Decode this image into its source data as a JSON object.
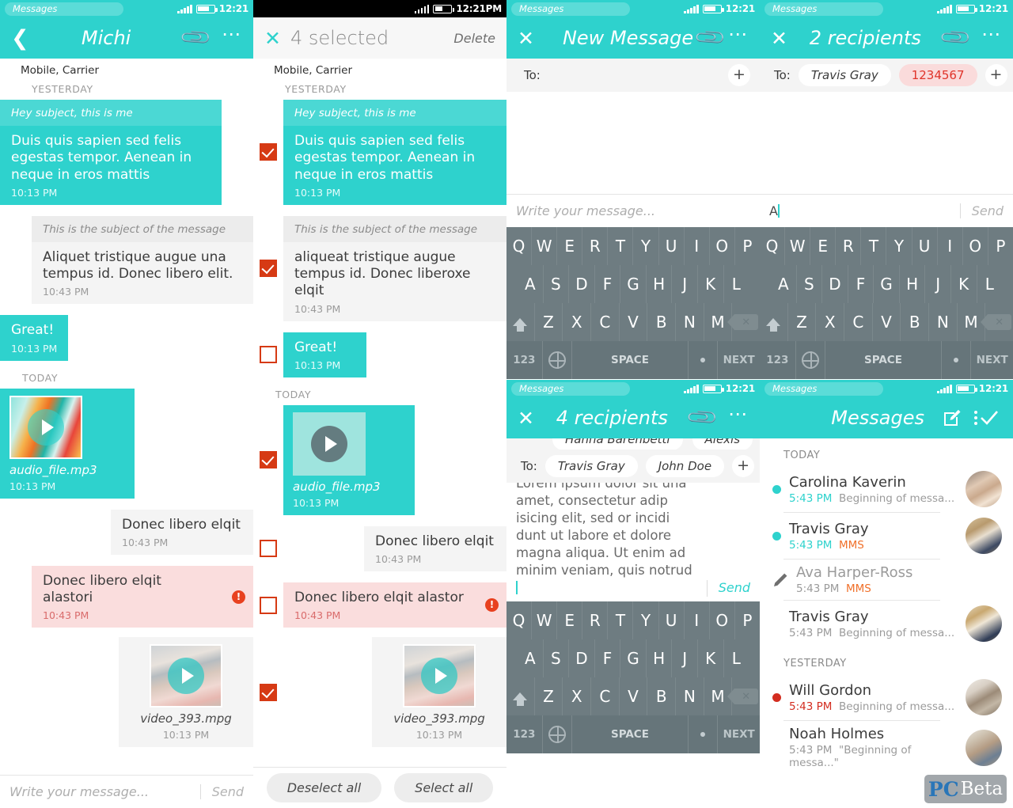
{
  "status": {
    "app_label": "Messages",
    "time": "12:21",
    "time_pm": "12:21PM"
  },
  "panel_conversation": {
    "title": "Michi",
    "carrier": "Mobile, Carrier",
    "day_yesterday": "YESTERDAY",
    "day_today": "TODAY",
    "compose_placeholder": "Write your message...",
    "send_label": "Send",
    "messages": [
      {
        "subject": "Hey subject, this is me",
        "text": "Duis quis sapien sed felis egestas tempor. Aenean in neque in eros mattis",
        "time": "10:13 PM"
      },
      {
        "subject": "This is the subject of the message",
        "text": "Aliquet tristique augue una tempus id. Donec libero elit.",
        "time": "10:43 PM"
      },
      {
        "text": "Great!",
        "time": "10:13 PM"
      },
      {
        "filename": "audio_file.mp3",
        "time": "10:13 PM"
      },
      {
        "text": "Donec libero elqit",
        "time": "10:43 PM"
      },
      {
        "text": "Donec libero elqit alastori",
        "time": "10:43 PM",
        "error": "!"
      },
      {
        "filename": "video_393.mpg",
        "time": "10:13 PM"
      }
    ]
  },
  "panel_selection": {
    "title": "4 selected",
    "delete_label": "Delete",
    "carrier": "Mobile, Carrier",
    "day_yesterday": "YESTERDAY",
    "day_today": "TODAY",
    "deselect_all_label": "Deselect all",
    "select_all_label": "Select all",
    "messages": [
      {
        "subject": "Hey subject, this is me",
        "text": "Duis quis sapien sed felis egestas tempor. Aenean in neque in eros mattis",
        "time": "10:13 PM",
        "checked": true
      },
      {
        "subject": "This is the subject of the message",
        "text": "aliqueat tristique augue tempus id. Donec liberoxe elqit",
        "time": "10:43 PM",
        "checked": true
      },
      {
        "text": "Great!",
        "time": "10:13 PM",
        "checked": false
      },
      {
        "filename": "audio_file.mp3",
        "time": "10:13 PM",
        "checked": true
      },
      {
        "text": "Donec libero elqit",
        "time": "10:43 PM",
        "checked": false
      },
      {
        "text": "Donec libero elqit alastor",
        "time": "10:43 PM",
        "checked": false,
        "error": "!"
      },
      {
        "filename": "video_393.mpg",
        "time": "10:13 PM",
        "checked": true
      }
    ]
  },
  "panel_new_message": {
    "title": "New Message",
    "to_label": "To:",
    "add_label": "+",
    "compose_placeholder": "Write your message...",
    "send_label": "Send"
  },
  "panel_two_recipients": {
    "title": "2 recipients",
    "to_label": "To:",
    "add_label": "+",
    "recipients": [
      {
        "name": "Travis Gray",
        "invalid": false
      },
      {
        "name": "1234567",
        "invalid": true
      }
    ],
    "typed_text": "A",
    "send_label": "Send"
  },
  "panel_four_recipients": {
    "title": "4 recipients",
    "to_label": "To:",
    "add_label": "+",
    "recipients_hidden": [
      {
        "name": "Hanna Barenbetti"
      },
      {
        "name": "Alexis"
      }
    ],
    "recipients": [
      {
        "name": "Travis Gray"
      },
      {
        "name": "John Doe"
      }
    ],
    "message_text": "Lorem ipsum dolor sit una amet, consectetur adip isicing elit, sed or incidi dunt ut labore et dolore magna aliqua. Ut enim ad minim veniam, quis notrud",
    "send_label": "Send"
  },
  "keyboard": {
    "row1": [
      "Q",
      "W",
      "E",
      "R",
      "T",
      "Y",
      "U",
      "I",
      "O",
      "P"
    ],
    "row2": [
      "A",
      "S",
      "D",
      "F",
      "G",
      "H",
      "J",
      "K",
      "L"
    ],
    "row3": [
      "Z",
      "X",
      "C",
      "V",
      "B",
      "N",
      "M"
    ],
    "shift_icon": "shift-icon",
    "backspace_icon": "backspace-icon",
    "num_label": "123",
    "globe_icon": "globe-icon",
    "space_label": "SPACE",
    "dot_label": ".",
    "next_label": "NEXT"
  },
  "panel_message_list": {
    "title": "Messages",
    "compose_icon": "compose-icon",
    "overflow_icon": "more-vertical-icon",
    "check_icon": "check-icon",
    "day_today": "TODAY",
    "day_yesterday": "YESTERDAY",
    "items": [
      {
        "name": "Carolina Kaverin",
        "time": "5:43 PM",
        "preview": "Beginning of messa...",
        "unread": true,
        "dot_color": "#2ed2cd",
        "time_color": "#2ed2cd",
        "avatar": true,
        "draft": false
      },
      {
        "name": "Travis Gray",
        "time": "5:43 PM",
        "preview": "MMS",
        "preview_is_mms": true,
        "unread": true,
        "dot_color": "#2ed2cd",
        "time_color": "#2ed2cd",
        "avatar": true,
        "draft": false
      },
      {
        "name": "Ava Harper-Ross",
        "time": "5:43 PM",
        "preview": "MMS",
        "preview_is_mms": true,
        "unread": false,
        "time_color": "#9b9b9b",
        "avatar": false,
        "draft": true
      },
      {
        "name": "Travis Gray",
        "time": "5:43 PM",
        "preview": "Beginning of messa...",
        "unread": false,
        "time_color": "#9b9b9b",
        "avatar": true,
        "draft": false
      },
      {
        "name": "Will Gordon",
        "time": "5:43 PM",
        "preview": "Beginning of messa...",
        "unread": true,
        "dot_color": "#d32d20",
        "time_color": "#d32d20",
        "avatar": true,
        "draft": false
      },
      {
        "name": "Noah Holmes",
        "time": "5:43 PM",
        "preview": "\"Beginning of messa...\"",
        "unread": false,
        "time_color": "#9b9b9b",
        "avatar": true,
        "draft": false
      }
    ]
  },
  "watermark": {
    "pc": "PC",
    "beta": "Beta"
  },
  "colors": {
    "teal": "#2ed2cd",
    "checkbox_red": "#d63a14",
    "error_red": "#e8411f",
    "mms_orange": "#f0702a",
    "keyboard_bg": "#6e7c81",
    "pink_bubble": "#fadddd"
  }
}
